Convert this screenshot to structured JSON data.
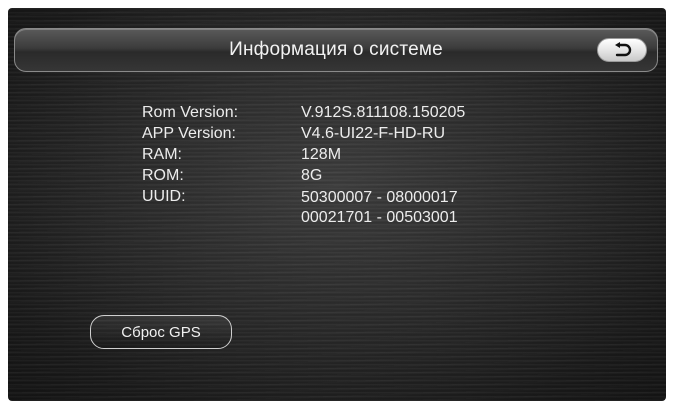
{
  "header": {
    "title": "Информация о системе",
    "back_icon": "back-arrow-icon"
  },
  "info": {
    "rom_version": {
      "label": "Rom Version:",
      "value": "V.912S.811108.150205"
    },
    "app_version": {
      "label": "APP Version:",
      "value": "V4.6-UI22-F-HD-RU"
    },
    "ram": {
      "label": "RAM:",
      "value": "128M"
    },
    "rom": {
      "label": "ROM:",
      "value": "8G"
    },
    "uuid": {
      "label": "UUID:",
      "line1": "50300007 - 08000017",
      "line2": "00021701 - 00503001"
    }
  },
  "actions": {
    "reset_gps_label": "Сброс GPS"
  }
}
